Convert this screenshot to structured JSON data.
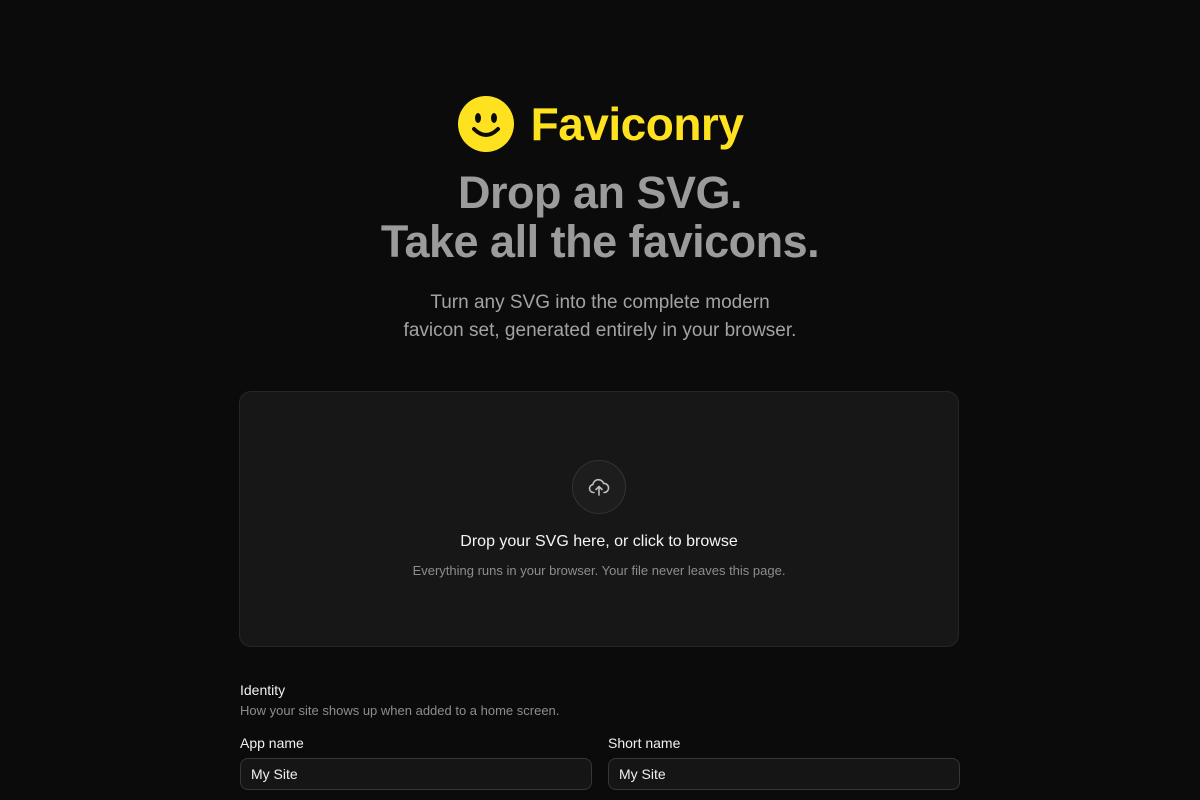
{
  "brand": {
    "name": "Faviconry",
    "logo_icon": "smiley-face-icon",
    "accent_color": "#ffe21f"
  },
  "hero": {
    "headline_line1": "Drop an SVG.",
    "headline_line2": "Take all the favicons.",
    "subhead_line1": "Turn any SVG into the complete modern",
    "subhead_line2": "favicon set, generated entirely in your browser."
  },
  "dropzone": {
    "icon": "cloud-upload-icon",
    "title": "Drop your SVG here, or click to browse",
    "note": "Everything runs in your browser. Your file never leaves this page."
  },
  "identity": {
    "title": "Identity",
    "description": "How your site shows up when added to a home screen.",
    "app_name": {
      "label": "App name",
      "value": "My Site"
    },
    "short_name": {
      "label": "Short name",
      "value": "My Site"
    }
  }
}
